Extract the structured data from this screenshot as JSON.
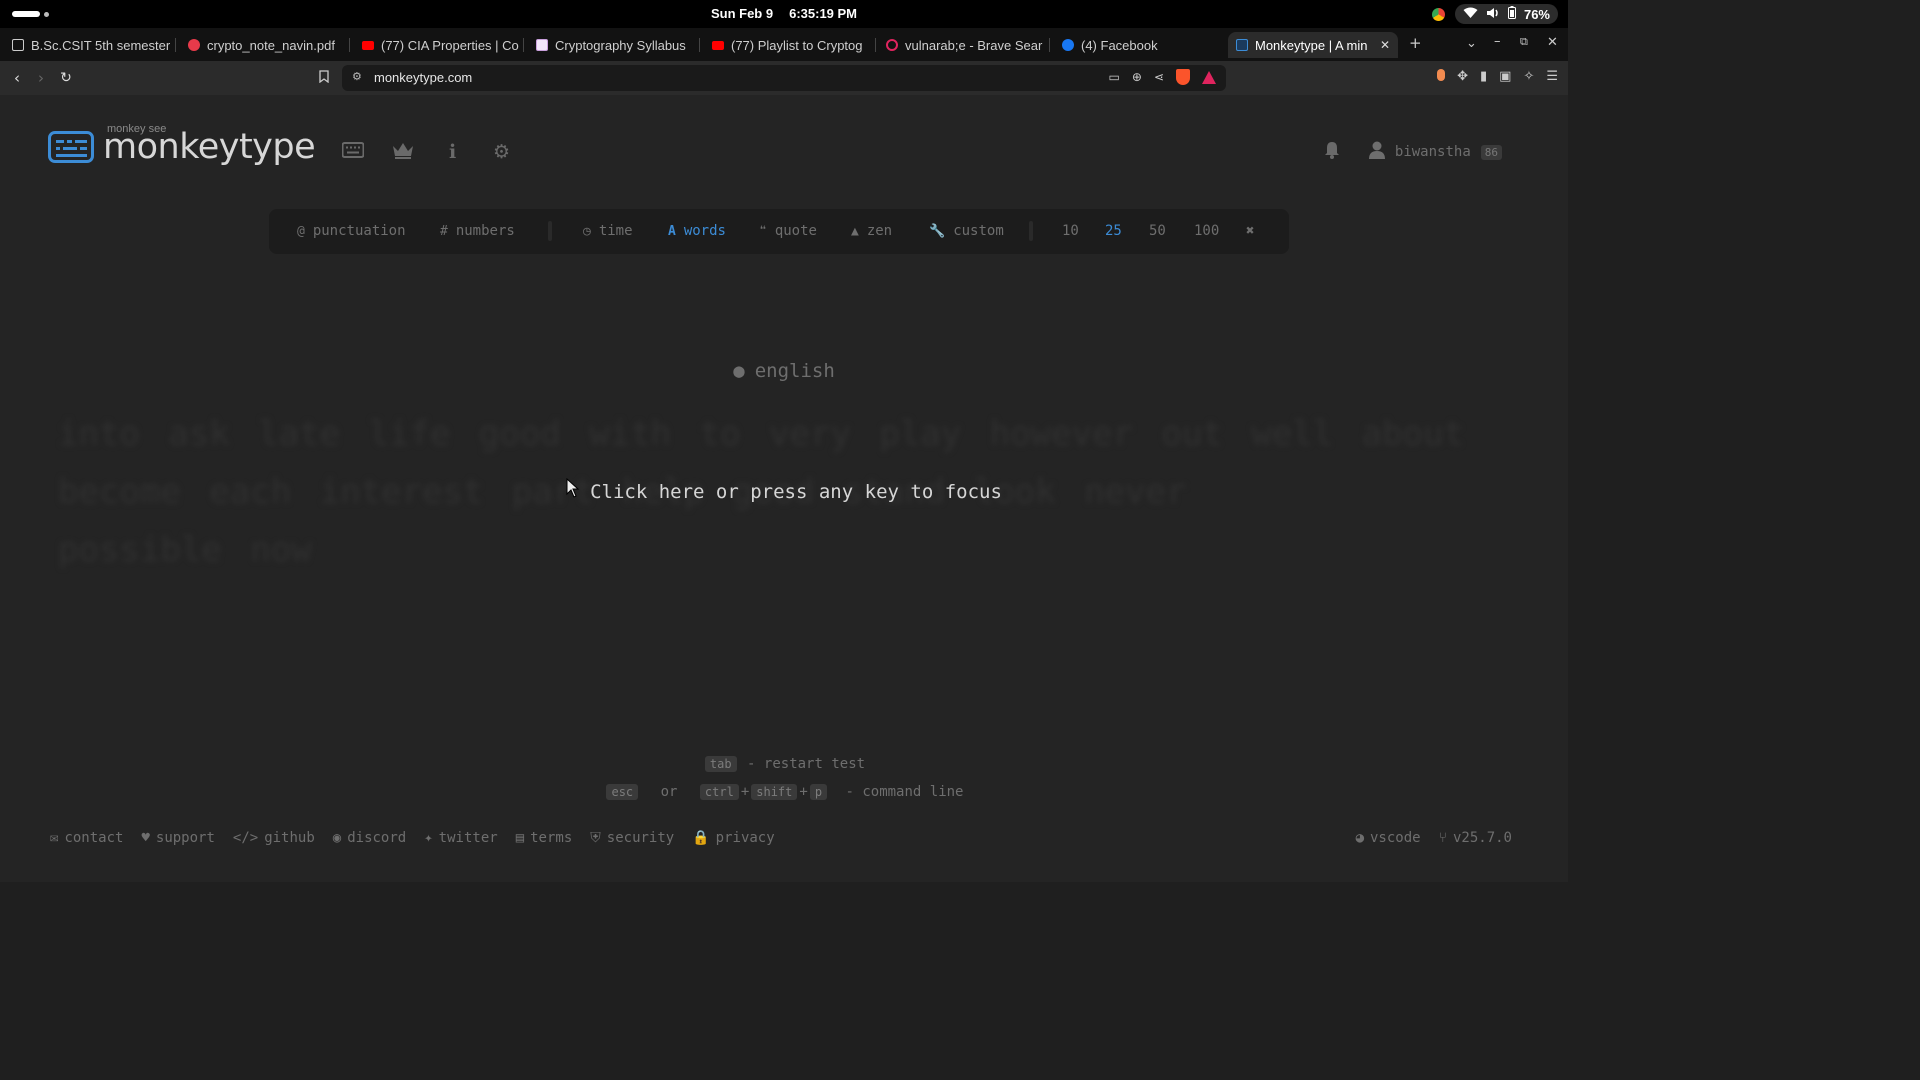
{
  "os": {
    "date": "Sun Feb 9",
    "time": "6:35:19 PM",
    "battery": "76%"
  },
  "browser": {
    "tabs": [
      {
        "label": "B.Sc.CSIT 5th semester",
        "favicon": "doc-icon",
        "color": "#cccccc"
      },
      {
        "label": "crypto_note_navin.pdf",
        "favicon": "pdf-icon",
        "color": "#e83a4a"
      },
      {
        "label": "(77) CIA Properties | Co",
        "favicon": "youtube-icon",
        "color": "#ff0000"
      },
      {
        "label": "Cryptography Syllabus",
        "favicon": "page-icon",
        "color": "#c9a0dc"
      },
      {
        "label": "(77) Playlist to Cryptog",
        "favicon": "youtube-icon",
        "color": "#ff0000"
      },
      {
        "label": "vulnarab;e - Brave Sear",
        "favicon": "brave-search-icon",
        "color": "#e0245e"
      },
      {
        "label": "(4) Facebook",
        "favicon": "facebook-icon",
        "color": "#1877f2"
      },
      {
        "label": "Monkeytype | A min",
        "favicon": "monkeytype-icon",
        "color": "#3c8cd6"
      }
    ],
    "url": "monkeytype.com"
  },
  "site": {
    "logo_small": "monkey see",
    "logo_big": "monkeytype",
    "username": "biwanstha",
    "level": "86",
    "accent": "#3c8cd6"
  },
  "config": {
    "punctuation": "punctuation",
    "numbers": "numbers",
    "time": "time",
    "words": "words",
    "quote": "quote",
    "zen": "zen",
    "custom": "custom",
    "counts": [
      "10",
      "25",
      "50",
      "100"
    ],
    "selected_count": "25"
  },
  "test": {
    "language": "english",
    "words_line1": "into ask late life good with to very play however out well about",
    "words_line2": "become each interest part help good stand look never",
    "words_line3": "possible now",
    "focus_message": "Click here or press any key to focus"
  },
  "hints": {
    "tab_key": "tab",
    "restart": "- restart test",
    "esc_key": "esc",
    "or": "or",
    "ctrl_key": "ctrl",
    "plus": "+",
    "shift_key": "shift",
    "p_key": "p",
    "command_line": "- command line"
  },
  "footer": {
    "links": [
      "contact",
      "support",
      "github",
      "discord",
      "twitter",
      "terms",
      "security",
      "privacy"
    ],
    "theme": "vscode",
    "version": "v25.7.0"
  }
}
